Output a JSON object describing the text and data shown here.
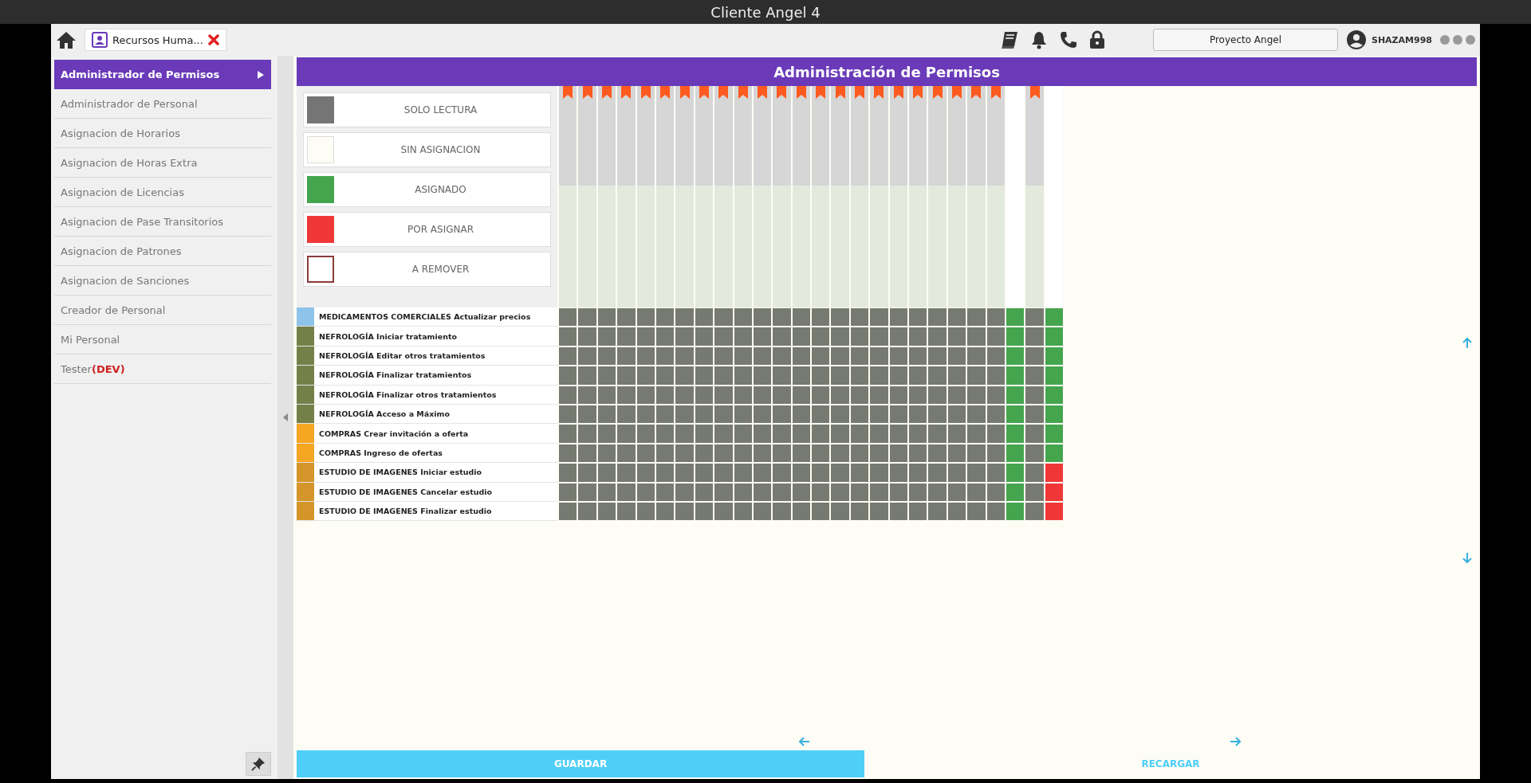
{
  "window": {
    "title": "Cliente Angel 4"
  },
  "tab": {
    "label": "Recursos Huma..."
  },
  "project_button": "Proyecto Angel",
  "user": "SHAZAM998",
  "sidebar": {
    "items": [
      {
        "label": "Administrador de Permisos",
        "selected": true
      },
      {
        "label": "Administrador de Personal",
        "selected": false
      },
      {
        "label": "Asignacion de Horarios",
        "selected": false
      },
      {
        "label": "Asignacion de Horas Extra",
        "selected": false
      },
      {
        "label": "Asignacion de Licencias",
        "selected": false
      },
      {
        "label": "Asignacion de Pase Transitorios",
        "selected": false
      },
      {
        "label": "Asignacion de Patrones",
        "selected": false
      },
      {
        "label": "Asignacion de Sanciones",
        "selected": false
      },
      {
        "label": "Creador de Personal",
        "selected": false
      },
      {
        "label": "Mi Personal",
        "selected": false
      },
      {
        "label": "Tester",
        "tag": "(DEV)",
        "selected": false
      }
    ]
  },
  "panel_title": "Administración de Permisos",
  "legend": [
    {
      "kind": "read_only",
      "label": "SOLO LECTURA"
    },
    {
      "kind": "unassigned",
      "label": "SIN ASIGNACION"
    },
    {
      "kind": "assigned",
      "label": "ASIGNADO"
    },
    {
      "kind": "to_assign",
      "label": "POR ASIGNAR"
    },
    {
      "kind": "to_remove",
      "label": "A REMOVER"
    }
  ],
  "columns": [
    {
      "bookmarked": true
    },
    {
      "bookmarked": true
    },
    {
      "bookmarked": true
    },
    {
      "bookmarked": true
    },
    {
      "bookmarked": true
    },
    {
      "bookmarked": true
    },
    {
      "bookmarked": true
    },
    {
      "bookmarked": true
    },
    {
      "bookmarked": true
    },
    {
      "bookmarked": true
    },
    {
      "bookmarked": true
    },
    {
      "bookmarked": true
    },
    {
      "bookmarked": true
    },
    {
      "bookmarked": true
    },
    {
      "bookmarked": true
    },
    {
      "bookmarked": true
    },
    {
      "bookmarked": true
    },
    {
      "bookmarked": true
    },
    {
      "bookmarked": true
    },
    {
      "bookmarked": true
    },
    {
      "bookmarked": true
    },
    {
      "bookmarked": true
    },
    {
      "bookmarked": true
    },
    {
      "bookmarked": false
    },
    {
      "bookmarked": true
    },
    {
      "bookmarked": false
    }
  ],
  "rows": [
    {
      "color": "#8ec3ea",
      "label": "MEDICAMENTOS COMERCIALES Actualizar precios",
      "cells": [
        {
          "kind": "read_only"
        },
        {
          "kind": "read_only"
        },
        {
          "kind": "read_only"
        },
        {
          "kind": "read_only"
        },
        {
          "kind": "read_only"
        },
        {
          "kind": "read_only"
        },
        {
          "kind": "read_only"
        },
        {
          "kind": "read_only"
        },
        {
          "kind": "read_only"
        },
        {
          "kind": "read_only"
        },
        {
          "kind": "read_only"
        },
        {
          "kind": "read_only"
        },
        {
          "kind": "read_only"
        },
        {
          "kind": "read_only"
        },
        {
          "kind": "read_only"
        },
        {
          "kind": "read_only"
        },
        {
          "kind": "read_only"
        },
        {
          "kind": "read_only"
        },
        {
          "kind": "read_only"
        },
        {
          "kind": "read_only"
        },
        {
          "kind": "read_only"
        },
        {
          "kind": "read_only"
        },
        {
          "kind": "read_only"
        },
        {
          "kind": "assigned"
        },
        {
          "kind": "read_only"
        },
        {
          "kind": "assigned"
        }
      ]
    },
    {
      "color": "#738048",
      "label": "NEFROLOGÍA Iniciar tratamiento",
      "cells": [
        {
          "kind": "read_only"
        },
        {
          "kind": "read_only"
        },
        {
          "kind": "read_only"
        },
        {
          "kind": "read_only"
        },
        {
          "kind": "read_only"
        },
        {
          "kind": "read_only"
        },
        {
          "kind": "read_only"
        },
        {
          "kind": "read_only"
        },
        {
          "kind": "read_only"
        },
        {
          "kind": "read_only"
        },
        {
          "kind": "read_only"
        },
        {
          "kind": "read_only"
        },
        {
          "kind": "read_only"
        },
        {
          "kind": "read_only"
        },
        {
          "kind": "read_only"
        },
        {
          "kind": "read_only"
        },
        {
          "kind": "read_only"
        },
        {
          "kind": "read_only"
        },
        {
          "kind": "read_only"
        },
        {
          "kind": "read_only"
        },
        {
          "kind": "read_only"
        },
        {
          "kind": "read_only"
        },
        {
          "kind": "read_only"
        },
        {
          "kind": "assigned"
        },
        {
          "kind": "read_only"
        },
        {
          "kind": "assigned"
        }
      ]
    },
    {
      "color": "#738048",
      "label": "NEFROLOGÍA Editar otros tratamientos",
      "cells": [
        {
          "kind": "read_only"
        },
        {
          "kind": "read_only"
        },
        {
          "kind": "read_only"
        },
        {
          "kind": "read_only"
        },
        {
          "kind": "read_only"
        },
        {
          "kind": "read_only"
        },
        {
          "kind": "read_only"
        },
        {
          "kind": "read_only"
        },
        {
          "kind": "read_only"
        },
        {
          "kind": "read_only"
        },
        {
          "kind": "read_only"
        },
        {
          "kind": "read_only"
        },
        {
          "kind": "read_only"
        },
        {
          "kind": "read_only"
        },
        {
          "kind": "read_only"
        },
        {
          "kind": "read_only"
        },
        {
          "kind": "read_only"
        },
        {
          "kind": "read_only"
        },
        {
          "kind": "read_only"
        },
        {
          "kind": "read_only"
        },
        {
          "kind": "read_only"
        },
        {
          "kind": "read_only"
        },
        {
          "kind": "read_only"
        },
        {
          "kind": "assigned"
        },
        {
          "kind": "read_only"
        },
        {
          "kind": "assigned"
        }
      ]
    },
    {
      "color": "#738048",
      "label": "NEFROLOGÍA Finalizar tratamientos",
      "cells": [
        {
          "kind": "read_only"
        },
        {
          "kind": "read_only"
        },
        {
          "kind": "read_only"
        },
        {
          "kind": "read_only"
        },
        {
          "kind": "read_only"
        },
        {
          "kind": "read_only"
        },
        {
          "kind": "read_only"
        },
        {
          "kind": "read_only"
        },
        {
          "kind": "read_only"
        },
        {
          "kind": "read_only"
        },
        {
          "kind": "read_only"
        },
        {
          "kind": "read_only"
        },
        {
          "kind": "read_only"
        },
        {
          "kind": "read_only"
        },
        {
          "kind": "read_only"
        },
        {
          "kind": "read_only"
        },
        {
          "kind": "read_only"
        },
        {
          "kind": "read_only"
        },
        {
          "kind": "read_only"
        },
        {
          "kind": "read_only"
        },
        {
          "kind": "read_only"
        },
        {
          "kind": "read_only"
        },
        {
          "kind": "read_only"
        },
        {
          "kind": "assigned"
        },
        {
          "kind": "read_only"
        },
        {
          "kind": "assigned"
        }
      ]
    },
    {
      "color": "#738048",
      "label": "NEFROLOGÍA Finalizar otros tratamientos",
      "cells": [
        {
          "kind": "read_only"
        },
        {
          "kind": "read_only"
        },
        {
          "kind": "read_only"
        },
        {
          "kind": "read_only"
        },
        {
          "kind": "read_only"
        },
        {
          "kind": "read_only"
        },
        {
          "kind": "read_only"
        },
        {
          "kind": "read_only"
        },
        {
          "kind": "read_only"
        },
        {
          "kind": "read_only"
        },
        {
          "kind": "read_only"
        },
        {
          "kind": "read_only"
        },
        {
          "kind": "read_only"
        },
        {
          "kind": "read_only"
        },
        {
          "kind": "read_only"
        },
        {
          "kind": "read_only"
        },
        {
          "kind": "read_only"
        },
        {
          "kind": "read_only"
        },
        {
          "kind": "read_only"
        },
        {
          "kind": "read_only"
        },
        {
          "kind": "read_only"
        },
        {
          "kind": "read_only"
        },
        {
          "kind": "read_only"
        },
        {
          "kind": "assigned"
        },
        {
          "kind": "read_only"
        },
        {
          "kind": "assigned"
        }
      ]
    },
    {
      "color": "#738048",
      "label": "NEFROLOGÍA Acceso a Máximo",
      "cells": [
        {
          "kind": "read_only"
        },
        {
          "kind": "read_only"
        },
        {
          "kind": "read_only"
        },
        {
          "kind": "read_only"
        },
        {
          "kind": "read_only"
        },
        {
          "kind": "read_only"
        },
        {
          "kind": "read_only"
        },
        {
          "kind": "read_only"
        },
        {
          "kind": "read_only"
        },
        {
          "kind": "read_only"
        },
        {
          "kind": "read_only"
        },
        {
          "kind": "read_only"
        },
        {
          "kind": "read_only"
        },
        {
          "kind": "read_only"
        },
        {
          "kind": "read_only"
        },
        {
          "kind": "read_only"
        },
        {
          "kind": "read_only"
        },
        {
          "kind": "read_only"
        },
        {
          "kind": "read_only"
        },
        {
          "kind": "read_only"
        },
        {
          "kind": "read_only"
        },
        {
          "kind": "read_only"
        },
        {
          "kind": "read_only"
        },
        {
          "kind": "assigned"
        },
        {
          "kind": "read_only"
        },
        {
          "kind": "assigned"
        }
      ]
    },
    {
      "color": "#f5a623",
      "label": "COMPRAS Crear invitación a oferta",
      "cells": [
        {
          "kind": "read_only"
        },
        {
          "kind": "read_only"
        },
        {
          "kind": "read_only"
        },
        {
          "kind": "read_only"
        },
        {
          "kind": "read_only"
        },
        {
          "kind": "read_only"
        },
        {
          "kind": "read_only"
        },
        {
          "kind": "read_only"
        },
        {
          "kind": "read_only"
        },
        {
          "kind": "read_only"
        },
        {
          "kind": "read_only"
        },
        {
          "kind": "read_only"
        },
        {
          "kind": "read_only"
        },
        {
          "kind": "read_only"
        },
        {
          "kind": "read_only"
        },
        {
          "kind": "read_only"
        },
        {
          "kind": "read_only"
        },
        {
          "kind": "read_only"
        },
        {
          "kind": "read_only"
        },
        {
          "kind": "read_only"
        },
        {
          "kind": "read_only"
        },
        {
          "kind": "read_only"
        },
        {
          "kind": "read_only"
        },
        {
          "kind": "assigned"
        },
        {
          "kind": "read_only"
        },
        {
          "kind": "assigned"
        }
      ]
    },
    {
      "color": "#f5a623",
      "label": "COMPRAS Ingreso de ofertas",
      "cells": [
        {
          "kind": "read_only"
        },
        {
          "kind": "read_only"
        },
        {
          "kind": "read_only"
        },
        {
          "kind": "read_only"
        },
        {
          "kind": "read_only"
        },
        {
          "kind": "read_only"
        },
        {
          "kind": "read_only"
        },
        {
          "kind": "read_only"
        },
        {
          "kind": "read_only"
        },
        {
          "kind": "read_only"
        },
        {
          "kind": "read_only"
        },
        {
          "kind": "read_only"
        },
        {
          "kind": "read_only"
        },
        {
          "kind": "read_only"
        },
        {
          "kind": "read_only"
        },
        {
          "kind": "read_only"
        },
        {
          "kind": "read_only"
        },
        {
          "kind": "read_only"
        },
        {
          "kind": "read_only"
        },
        {
          "kind": "read_only"
        },
        {
          "kind": "read_only"
        },
        {
          "kind": "read_only"
        },
        {
          "kind": "read_only"
        },
        {
          "kind": "assigned"
        },
        {
          "kind": "read_only"
        },
        {
          "kind": "assigned"
        }
      ]
    },
    {
      "color": "#d4962a",
      "label": "ESTUDIO DE IMAGENES Iniciar estudio",
      "cells": [
        {
          "kind": "read_only"
        },
        {
          "kind": "read_only"
        },
        {
          "kind": "read_only"
        },
        {
          "kind": "read_only"
        },
        {
          "kind": "read_only"
        },
        {
          "kind": "read_only"
        },
        {
          "kind": "read_only"
        },
        {
          "kind": "read_only"
        },
        {
          "kind": "read_only"
        },
        {
          "kind": "read_only"
        },
        {
          "kind": "read_only"
        },
        {
          "kind": "read_only"
        },
        {
          "kind": "read_only"
        },
        {
          "kind": "read_only"
        },
        {
          "kind": "read_only"
        },
        {
          "kind": "read_only"
        },
        {
          "kind": "read_only"
        },
        {
          "kind": "read_only"
        },
        {
          "kind": "read_only"
        },
        {
          "kind": "read_only"
        },
        {
          "kind": "read_only"
        },
        {
          "kind": "read_only"
        },
        {
          "kind": "read_only"
        },
        {
          "kind": "assigned"
        },
        {
          "kind": "read_only"
        },
        {
          "kind": "to_assign"
        }
      ]
    },
    {
      "color": "#d4962a",
      "label": "ESTUDIO DE IMAGENES Cancelar estudio",
      "cells": [
        {
          "kind": "read_only"
        },
        {
          "kind": "read_only"
        },
        {
          "kind": "read_only"
        },
        {
          "kind": "read_only"
        },
        {
          "kind": "read_only"
        },
        {
          "kind": "read_only"
        },
        {
          "kind": "read_only"
        },
        {
          "kind": "read_only"
        },
        {
          "kind": "read_only"
        },
        {
          "kind": "read_only"
        },
        {
          "kind": "read_only"
        },
        {
          "kind": "read_only"
        },
        {
          "kind": "read_only"
        },
        {
          "kind": "read_only"
        },
        {
          "kind": "read_only"
        },
        {
          "kind": "read_only"
        },
        {
          "kind": "read_only"
        },
        {
          "kind": "read_only"
        },
        {
          "kind": "read_only"
        },
        {
          "kind": "read_only"
        },
        {
          "kind": "read_only"
        },
        {
          "kind": "read_only"
        },
        {
          "kind": "read_only"
        },
        {
          "kind": "assigned"
        },
        {
          "kind": "read_only"
        },
        {
          "kind": "to_assign"
        }
      ]
    },
    {
      "color": "#d4962a",
      "label": "ESTUDIO DE IMAGENES Finalizar estudio",
      "cells": [
        {
          "kind": "read_only"
        },
        {
          "kind": "read_only"
        },
        {
          "kind": "read_only"
        },
        {
          "kind": "read_only"
        },
        {
          "kind": "read_only"
        },
        {
          "kind": "read_only"
        },
        {
          "kind": "read_only"
        },
        {
          "kind": "read_only"
        },
        {
          "kind": "read_only"
        },
        {
          "kind": "read_only"
        },
        {
          "kind": "read_only"
        },
        {
          "kind": "read_only"
        },
        {
          "kind": "read_only"
        },
        {
          "kind": "read_only"
        },
        {
          "kind": "read_only"
        },
        {
          "kind": "read_only"
        },
        {
          "kind": "read_only"
        },
        {
          "kind": "read_only"
        },
        {
          "kind": "read_only"
        },
        {
          "kind": "read_only"
        },
        {
          "kind": "read_only"
        },
        {
          "kind": "read_only"
        },
        {
          "kind": "read_only"
        },
        {
          "kind": "assigned"
        },
        {
          "kind": "read_only"
        },
        {
          "kind": "to_assign"
        }
      ]
    }
  ],
  "buttons": {
    "save": "GUARDAR",
    "reload": "RECARGAR"
  }
}
